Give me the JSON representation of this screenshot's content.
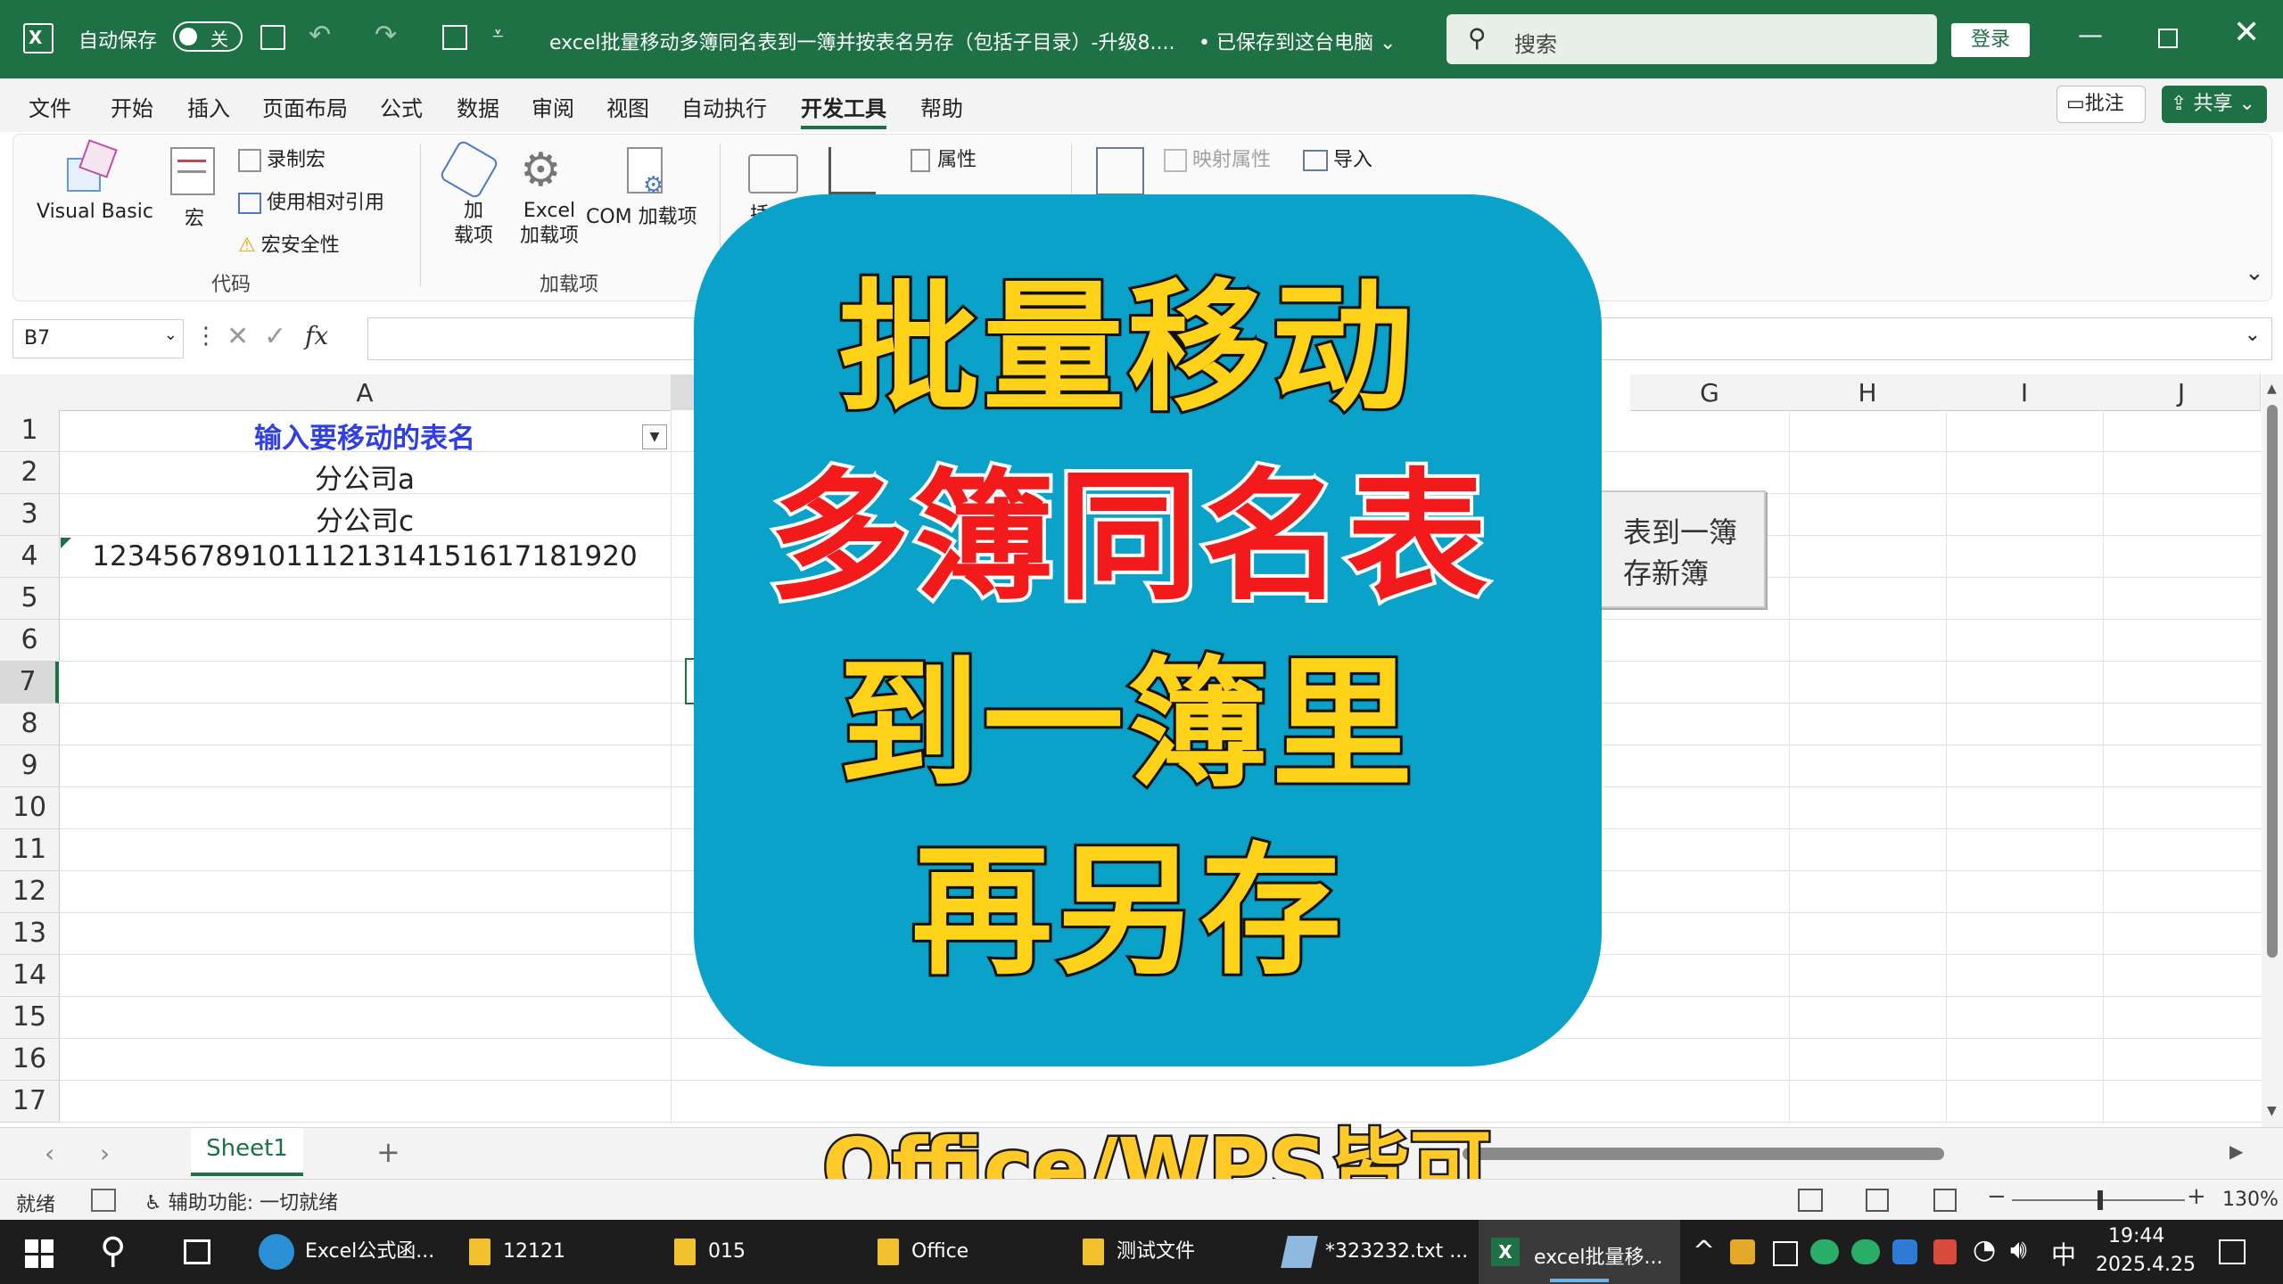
{
  "titlebar": {
    "autosave_label": "自动保存",
    "autosave_state": "关",
    "doc_title": "excel批量移动多簿同名表到一簿并按表名另存（包括子目录）-升级8....",
    "save_status": "• 已保存到这台电脑",
    "search_placeholder": "搜索",
    "signin_label": "登录"
  },
  "ribbon_tabs": [
    "文件",
    "开始",
    "插入",
    "页面布局",
    "公式",
    "数据",
    "审阅",
    "视图",
    "自动执行",
    "开发工具",
    "帮助"
  ],
  "ribbon_right": {
    "comments_label": "批注",
    "share_label": "共享"
  },
  "ribbon": {
    "code_group": {
      "visual_basic": "Visual Basic",
      "macros": "宏",
      "record_macro": "录制宏",
      "relative_ref": "使用相对引用",
      "macro_security": "宏安全性",
      "group_label": "代码"
    },
    "addins_group": {
      "addins_line1": "加",
      "addins_line2": "载项",
      "excel_addins_line1": "Excel",
      "excel_addins_line2": "加载项",
      "com_addins": "COM 加载项",
      "group_label": "加载项"
    },
    "controls_group": {
      "insert": "插入",
      "properties": "属性"
    },
    "xml_group": {
      "map_properties": "映射属性",
      "import": "导入"
    }
  },
  "formula_bar": {
    "name_box": "B7",
    "fx_label": "fx",
    "formula": ""
  },
  "columns": [
    "A",
    "G",
    "H",
    "I",
    "J"
  ],
  "rows": [
    "1",
    "2",
    "3",
    "4",
    "5",
    "6",
    "7",
    "8",
    "9",
    "10",
    "11",
    "12",
    "13",
    "14",
    "15",
    "16",
    "17"
  ],
  "cells": {
    "A1": "输入要移动的表名",
    "A2": "分公司a",
    "A3": "分公司c",
    "A4": "1234567891011121314151617181920"
  },
  "macro_button": {
    "line1": "表到一簿",
    "line2": "存新簿"
  },
  "overlay": {
    "line1": "批量移动",
    "line2": "多簿同名表",
    "line3": "到一簿里",
    "line4": "再另存",
    "bottom": "Office/WPS皆可"
  },
  "sheet_tabs": {
    "active": "Sheet1",
    "add_label": "+"
  },
  "statusbar": {
    "ready": "就绪",
    "accessibility": "辅助功能: 一切就绪",
    "zoom": "130%"
  },
  "taskbar": {
    "items": [
      "Excel公式函...",
      "12121",
      "015",
      "Office",
      "测试文件",
      "*323232.txt ...",
      "excel批量移..."
    ],
    "ime": "中",
    "time": "19:44",
    "date": "2025.4.25"
  },
  "colors": {
    "excel_green": "#1e7145",
    "card_blue": "#0aa2c8",
    "title_yellow": "#ffd21a",
    "title_red": "#f21a1a",
    "header_blue": "#2f3fe0"
  }
}
